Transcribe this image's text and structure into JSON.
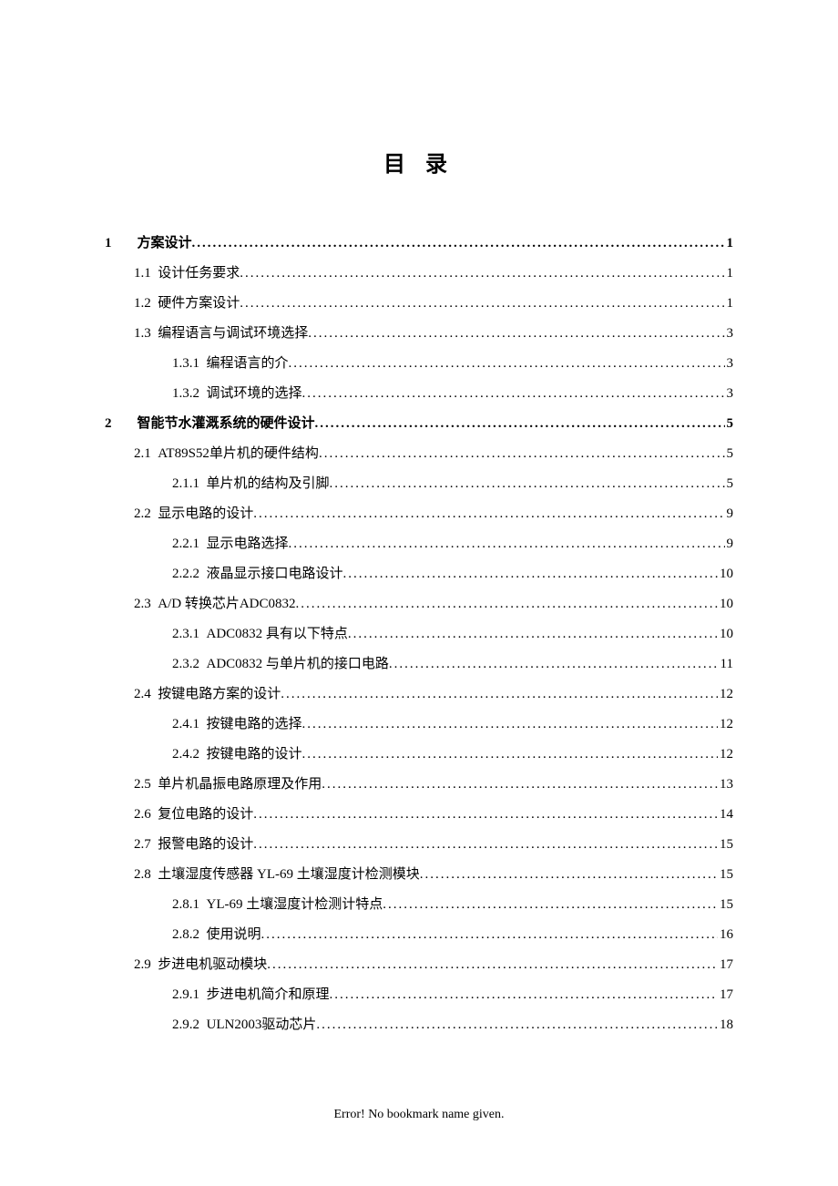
{
  "title": "目 录",
  "toc": [
    {
      "level": 1,
      "num": "1",
      "text": "方案设计",
      "page": "1"
    },
    {
      "level": 2,
      "num": "1.1",
      "text": "设计任务要求",
      "page": "1"
    },
    {
      "level": 2,
      "num": "1.2",
      "text": "硬件方案设计",
      "page": "1"
    },
    {
      "level": 2,
      "num": "1.3",
      "text": "编程语言与调试环境选择",
      "page": "3"
    },
    {
      "level": 3,
      "num": "1.3.1",
      "text": "编程语言的介",
      "page": "3"
    },
    {
      "level": 3,
      "num": "1.3.2",
      "text": "调试环境的选择",
      "page": "3"
    },
    {
      "level": 1,
      "num": "2",
      "text": "智能节水灌溉系统的硬件设计",
      "page": "5"
    },
    {
      "level": 2,
      "num": "2.1",
      "text": "AT89S52单片机的硬件结构",
      "page": "5"
    },
    {
      "level": 3,
      "num": "2.1.1",
      "text": "单片机的结构及引脚",
      "page": "5"
    },
    {
      "level": 2,
      "num": "2.2",
      "text": "显示电路的设计",
      "page": "9"
    },
    {
      "level": 3,
      "num": "2.2.1",
      "text": "显示电路选择",
      "page": "9"
    },
    {
      "level": 3,
      "num": "2.2.2",
      "text": "液晶显示接口电路设计",
      "page": "10"
    },
    {
      "level": 2,
      "num": "2.3",
      "text": "A/D 转换芯片ADC0832",
      "page": "10"
    },
    {
      "level": 3,
      "num": "2.3.1",
      "text": "ADC0832 具有以下特点",
      "page": "10"
    },
    {
      "level": 3,
      "num": "2.3.2",
      "text": "ADC0832 与单片机的接口电路",
      "page": "11"
    },
    {
      "level": 2,
      "num": "2.4",
      "text": "按键电路方案的设计",
      "page": "12"
    },
    {
      "level": 3,
      "num": "2.4.1",
      "text": "按键电路的选择",
      "page": "12"
    },
    {
      "level": 3,
      "num": "2.4.2",
      "text": "按键电路的设计",
      "page": "12"
    },
    {
      "level": 2,
      "num": "2.5",
      "text": "单片机晶振电路原理及作用",
      "page": "13"
    },
    {
      "level": 2,
      "num": "2.6",
      "text": "复位电路的设计",
      "page": "14"
    },
    {
      "level": 2,
      "num": "2.7",
      "text": "报警电路的设计",
      "page": "15"
    },
    {
      "level": 2,
      "num": "2.8",
      "text": "土壤湿度传感器 YL-69 土壤湿度计检测模块",
      "page": "15"
    },
    {
      "level": 3,
      "num": "2.8.1",
      "text": "YL-69 土壤湿度计检测计特点",
      "page": "15"
    },
    {
      "level": 3,
      "num": "2.8.2",
      "text": "使用说明",
      "page": "16"
    },
    {
      "level": 2,
      "num": "2.9",
      "text": "步进电机驱动模块",
      "page": "17"
    },
    {
      "level": 3,
      "num": "2.9.1",
      "text": "步进电机简介和原理",
      "page": "17"
    },
    {
      "level": 3,
      "num": "2.9.2",
      "text": "ULN2003驱动芯片",
      "page": "18"
    }
  ],
  "footer_error": "Error! No bookmark name given."
}
